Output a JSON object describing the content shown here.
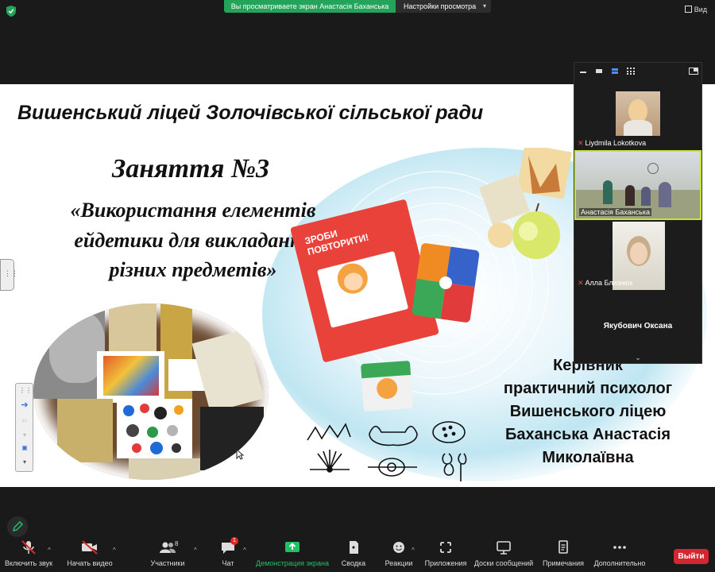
{
  "topbar": {
    "share_status": "Вы просматриваете экран Анастасія Баханська",
    "view_options": "Настройки просмотра",
    "view_button": "Вид"
  },
  "slide": {
    "school": "Вишенський ліцей Золочівської сільської ради",
    "lesson": "Заняття №3",
    "topic_lines": [
      "«Використання елементів",
      "ейдетики для викладання",
      "різних предметів»"
    ],
    "card_box_text": [
      "ЗРОБИ",
      "ПОВТОРИТИ!"
    ],
    "leader_lines": [
      "Керівник",
      "практичний психолог",
      "Вишенського ліцею",
      "Баханська Анастасія",
      "Миколаївна"
    ]
  },
  "gallery": {
    "participants": [
      {
        "name": "Liydmila Lokotkova",
        "muted": true
      },
      {
        "name": "Анастасія Баханська",
        "muted": false,
        "active": true
      },
      {
        "name": "Алла Близнюк",
        "muted": true
      },
      {
        "name": "Якубович Оксана",
        "muted": false
      }
    ],
    "more_label": "Якубович Оксана"
  },
  "toolbar": {
    "items": [
      {
        "label": "Включить звук",
        "icon": "mic-muted-icon"
      },
      {
        "label": "Начать видео",
        "icon": "video-off-icon"
      },
      {
        "label": "Участники",
        "icon": "participants-icon",
        "count": "8"
      },
      {
        "label": "Чат",
        "icon": "chat-icon",
        "badge": "1"
      },
      {
        "label": "Демонстрация экрана",
        "icon": "share-screen-icon"
      },
      {
        "label": "Своdка",
        "icon": "summary-icon"
      },
      {
        "label": "Реакции",
        "icon": "reactions-icon"
      },
      {
        "label": "Приложения",
        "icon": "apps-icon"
      },
      {
        "label": "Доски сообщений",
        "icon": "whiteboard-icon"
      },
      {
        "label": "Примечания",
        "icon": "notes-icon"
      },
      {
        "label": "Дополнительно",
        "icon": "more-icon"
      }
    ],
    "leave_label": "Выйти"
  },
  "colors": {
    "share_green": "#23a45a",
    "leave_red": "#d3262f",
    "active_border": "#c6e33a",
    "toolbar_bg": "#1a1a1a"
  }
}
